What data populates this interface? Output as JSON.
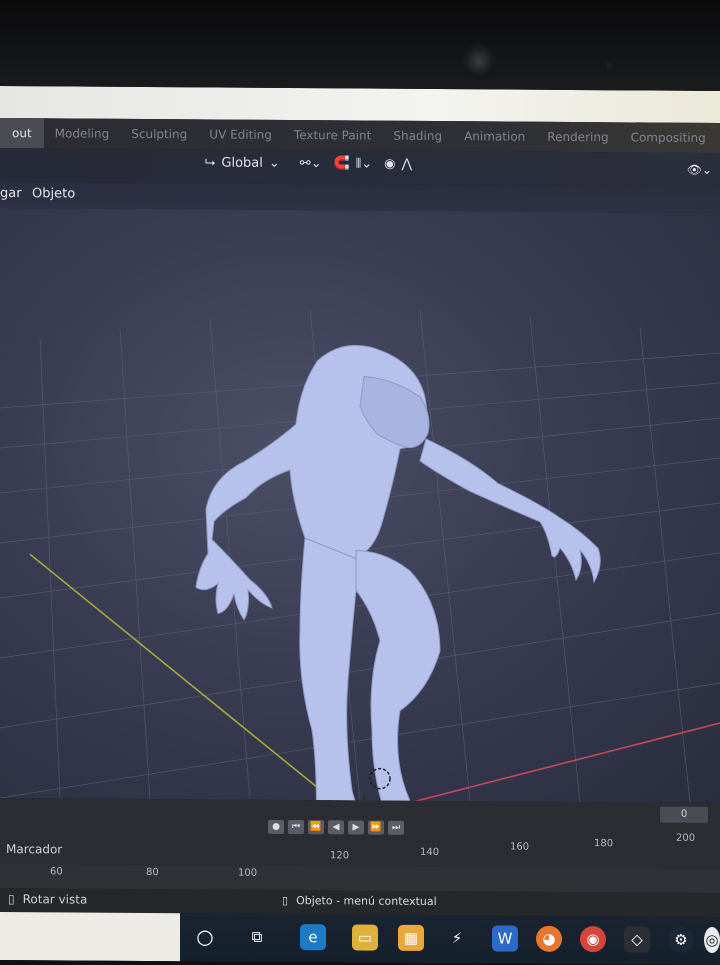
{
  "workspace_tabs": [
    "out",
    "Modeling",
    "Sculpting",
    "UV Editing",
    "Texture Paint",
    "Shading",
    "Animation",
    "Rendering",
    "Compositing"
  ],
  "active_tab": "out",
  "header": {
    "transform_orientation": "Global"
  },
  "menu": {
    "item_1": "gar",
    "item_2": "Objeto"
  },
  "timeline": {
    "current_frame": "0",
    "marker_label": "Marcador",
    "ticks_upper": [
      "120",
      "140",
      "160",
      "180",
      "200"
    ],
    "ticks_lower": [
      "60",
      "80",
      "100"
    ]
  },
  "status_bar": {
    "left_hint": "Rotar vista",
    "middle_hint": "Objeto - menú contextual"
  },
  "colors": {
    "viewport_bg": "#3a3c53",
    "model": "#b6c2ec",
    "x_axis": "#c04a5a",
    "y_axis": "#a8a83a"
  }
}
